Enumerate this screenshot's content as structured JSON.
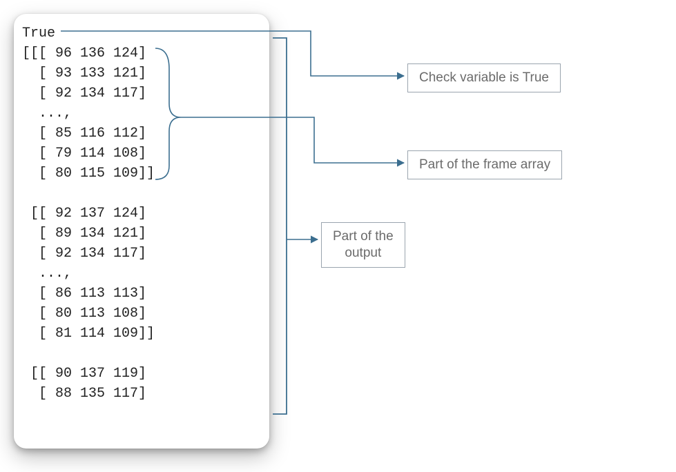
{
  "code": {
    "true_line": "True",
    "rows": [
      "[[[ 96 136 124]",
      "  [ 93 133 121]",
      "  [ 92 134 117]",
      "  ...,",
      "  [ 85 116 112]",
      "  [ 79 114 108]",
      "  [ 80 115 109]]",
      "",
      " [[ 92 137 124]",
      "  [ 89 134 121]",
      "  [ 92 134 117]",
      "  ...,",
      "  [ 86 113 113]",
      "  [ 80 113 108]",
      "  [ 81 114 109]]",
      "",
      " [[ 90 137 119]",
      "  [ 88 135 117]"
    ]
  },
  "callouts": {
    "check_variable": "Check variable is True",
    "frame_array": "Part of the frame array",
    "output": "Part of the\noutput"
  },
  "colors": {
    "connector": "#3b6e8f",
    "arrowhead": "#3b6e8f",
    "box_border": "#9aa4ae",
    "label_text": "#6b6b6b"
  }
}
